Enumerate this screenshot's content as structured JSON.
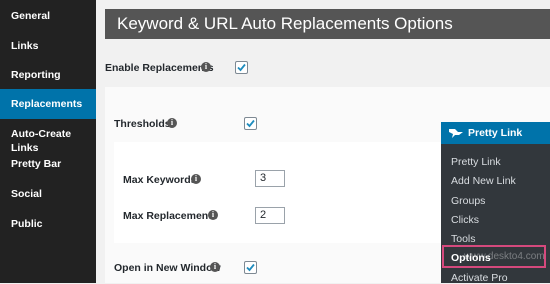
{
  "sidebar": {
    "items": [
      {
        "label": "General"
      },
      {
        "label": "Links"
      },
      {
        "label": "Reporting"
      },
      {
        "label": "Replacements",
        "active": true
      },
      {
        "label": "Auto-Create Links"
      },
      {
        "label": "Pretty Bar"
      },
      {
        "label": "Social"
      },
      {
        "label": "Public"
      }
    ]
  },
  "page": {
    "title": "Keyword & URL Auto Replacements Options"
  },
  "form": {
    "enable_replacements": {
      "label": "Enable Replacements",
      "checked": true
    },
    "thresholds": {
      "label": "Thresholds",
      "checked": true
    },
    "max_keywords": {
      "label": "Max Keywords",
      "value": "3"
    },
    "max_replacements": {
      "label": "Max Replacements",
      "value": "2"
    },
    "open_new_window": {
      "label": "Open in New Window",
      "checked": true
    }
  },
  "pretty_link_menu": {
    "title": "Pretty Link",
    "items": [
      {
        "label": "Pretty Link"
      },
      {
        "label": "Add New Link"
      },
      {
        "label": "Groups"
      },
      {
        "label": "Clicks"
      },
      {
        "label": "Tools"
      },
      {
        "label": "Options",
        "selected": true
      },
      {
        "label": "Activate Pro"
      }
    ]
  },
  "watermark": "www.deskto4.com",
  "colors": {
    "accent": "#0073aa",
    "sidebar": "#222222",
    "highlight": "#d5497d",
    "title_bar": "#555555"
  }
}
